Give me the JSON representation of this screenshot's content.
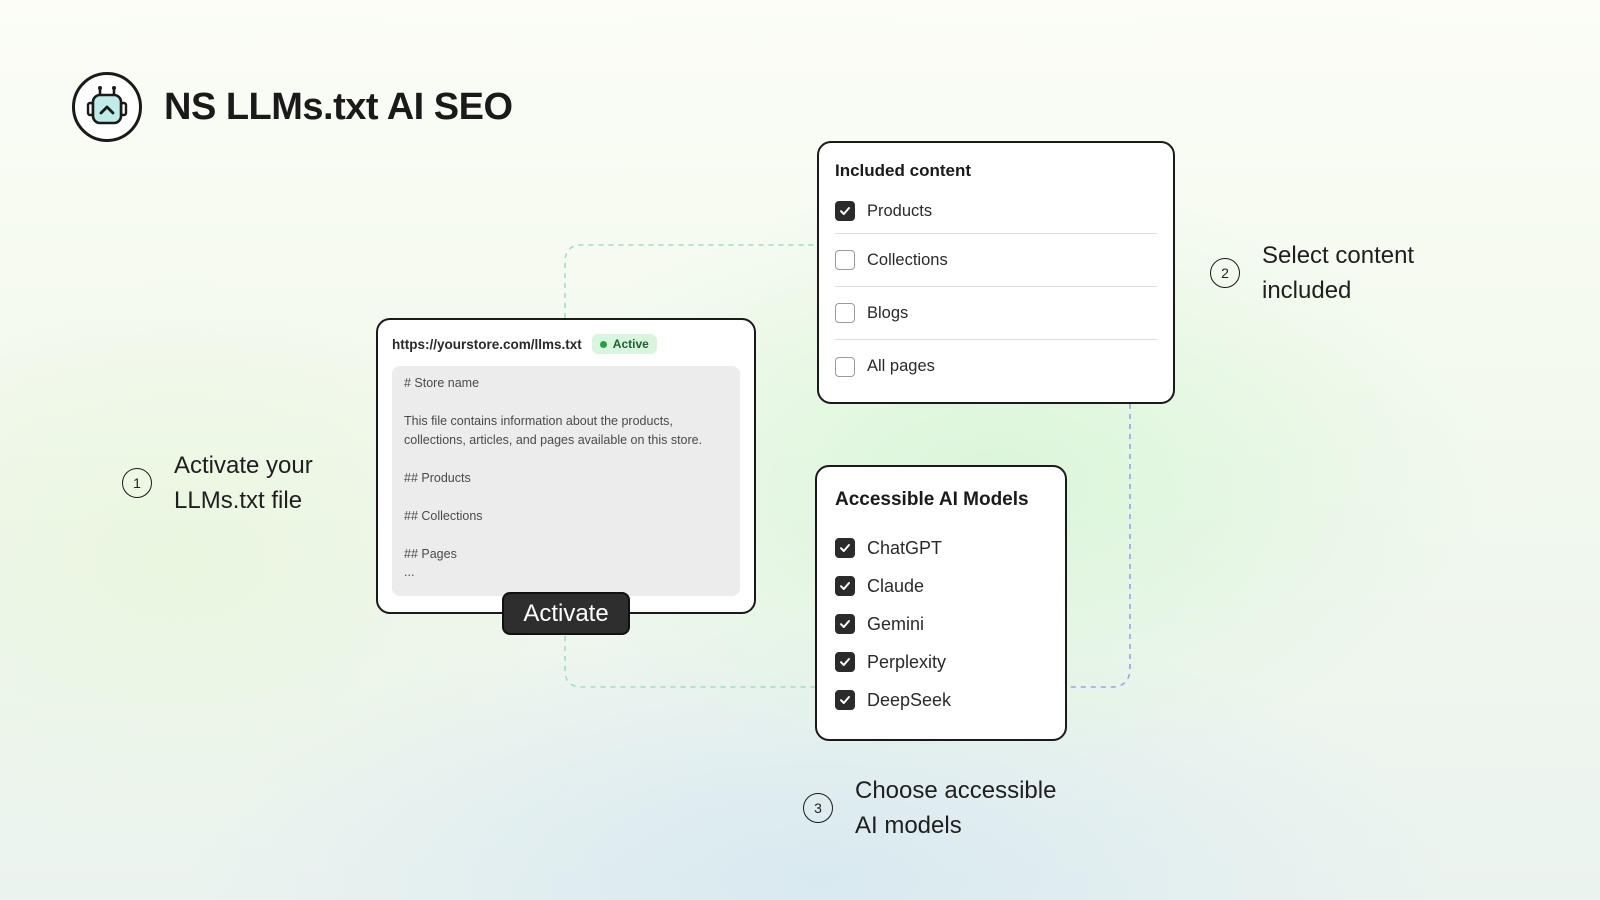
{
  "app": {
    "title": "NS LLMs.txt AI SEO",
    "logo_icon": "robot-icon"
  },
  "steps": [
    {
      "number": "1",
      "text": "Activate your\nLLMs.txt file"
    },
    {
      "number": "2",
      "text": "Select content\nincluded"
    },
    {
      "number": "3",
      "text": "Choose accessible\nAI models"
    }
  ],
  "llms_file": {
    "url": "https://yourstore.com/llms.txt",
    "status": "Active",
    "lines": [
      "# Store name",
      "This file contains information about the products, collections, articles, and pages available on this store.",
      "## Products",
      "## Collections",
      "## Pages",
      "..."
    ],
    "activate_label": "Activate"
  },
  "included_content": {
    "title": "Included content",
    "items": [
      {
        "label": "Products",
        "checked": true
      },
      {
        "label": "Collections",
        "checked": false
      },
      {
        "label": "Blogs",
        "checked": false
      },
      {
        "label": "All pages",
        "checked": false
      }
    ]
  },
  "ai_models": {
    "title": "Accessible AI Models",
    "items": [
      {
        "label": "ChatGPT",
        "checked": true
      },
      {
        "label": "Claude",
        "checked": true
      },
      {
        "label": "Gemini",
        "checked": true
      },
      {
        "label": "Perplexity",
        "checked": true
      },
      {
        "label": "DeepSeek",
        "checked": true
      }
    ]
  },
  "colors": {
    "connector_green": "#9fd9c2",
    "connector_blue": "#9aa6f0",
    "status_badge_bg": "#d9f5df",
    "status_dot": "#2a9d4a",
    "checkbox_checked": "#2b2b2b"
  }
}
